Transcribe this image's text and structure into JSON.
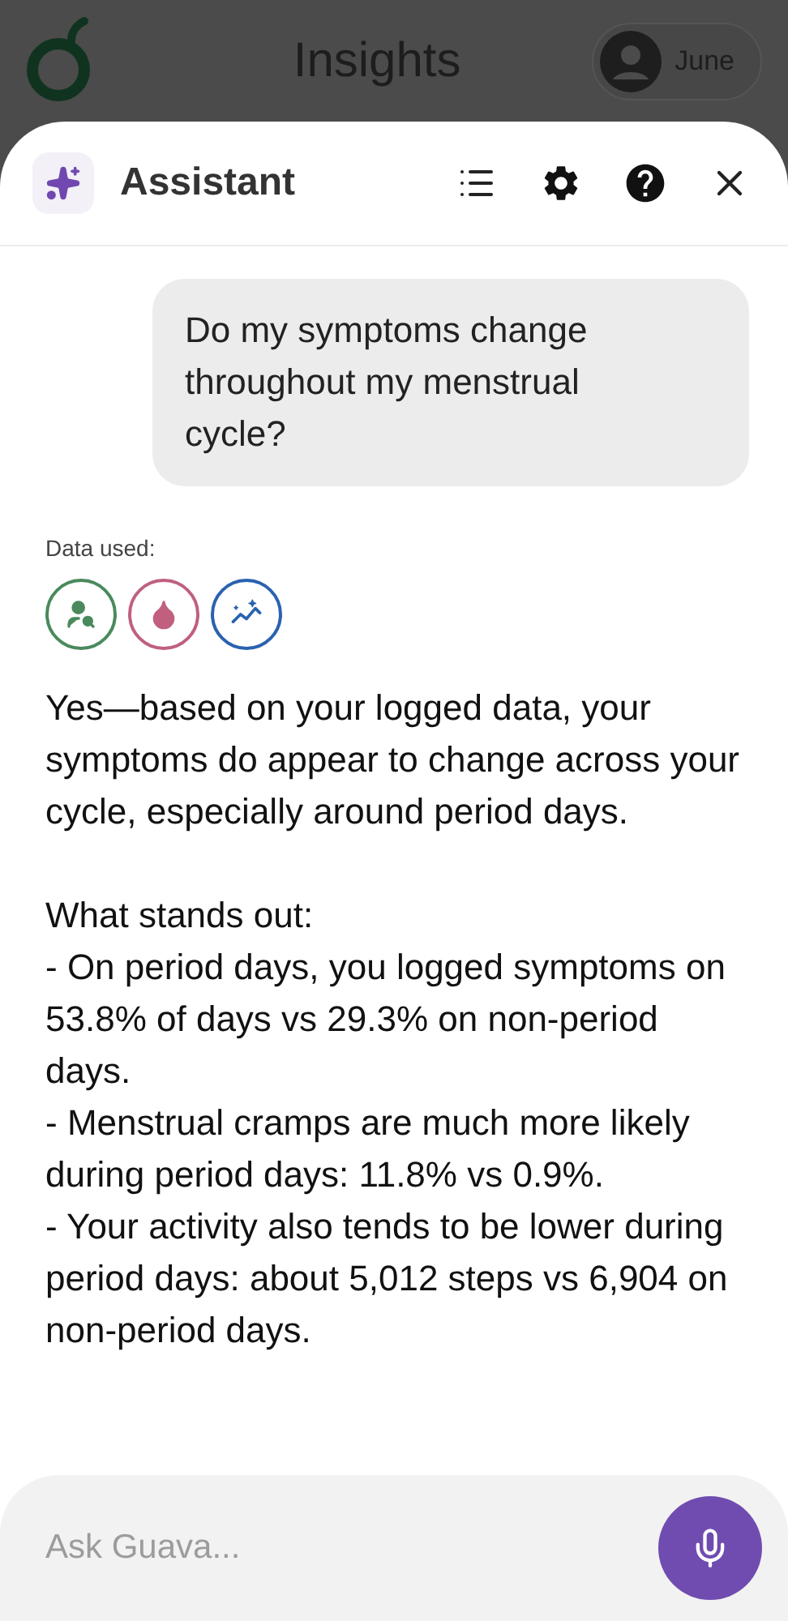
{
  "page_title": "Insights",
  "profile": {
    "name": "June"
  },
  "assistant": {
    "title": "Assistant"
  },
  "messages": [
    {
      "kind": "user",
      "text": "Do my symptoms change throughout my menstrual cycle?"
    },
    {
      "kind": "assistant",
      "data_used_label": "Data used:",
      "sources": [
        {
          "kind": "profile",
          "color": "#4a8a5c"
        },
        {
          "kind": "drop",
          "color": "#c0607e"
        },
        {
          "kind": "trend",
          "color": "#2a62b0"
        }
      ],
      "paragraphs": [
        [
          "Yes—based on your logged data, your symptoms do appear to change across your cycle, especially around period days."
        ],
        [
          "What stands out:",
          "- On period days, you logged symptoms on 53.8% of days vs 29.3% on non-period days.",
          "- Menstrual cramps are much more likely during period days: 11.8% vs 0.9%.",
          "- Your activity also tends to be lower during period days: about 5,012 steps vs 6,904 on non-period days."
        ]
      ]
    }
  ],
  "input": {
    "placeholder": "Ask Guava..."
  }
}
